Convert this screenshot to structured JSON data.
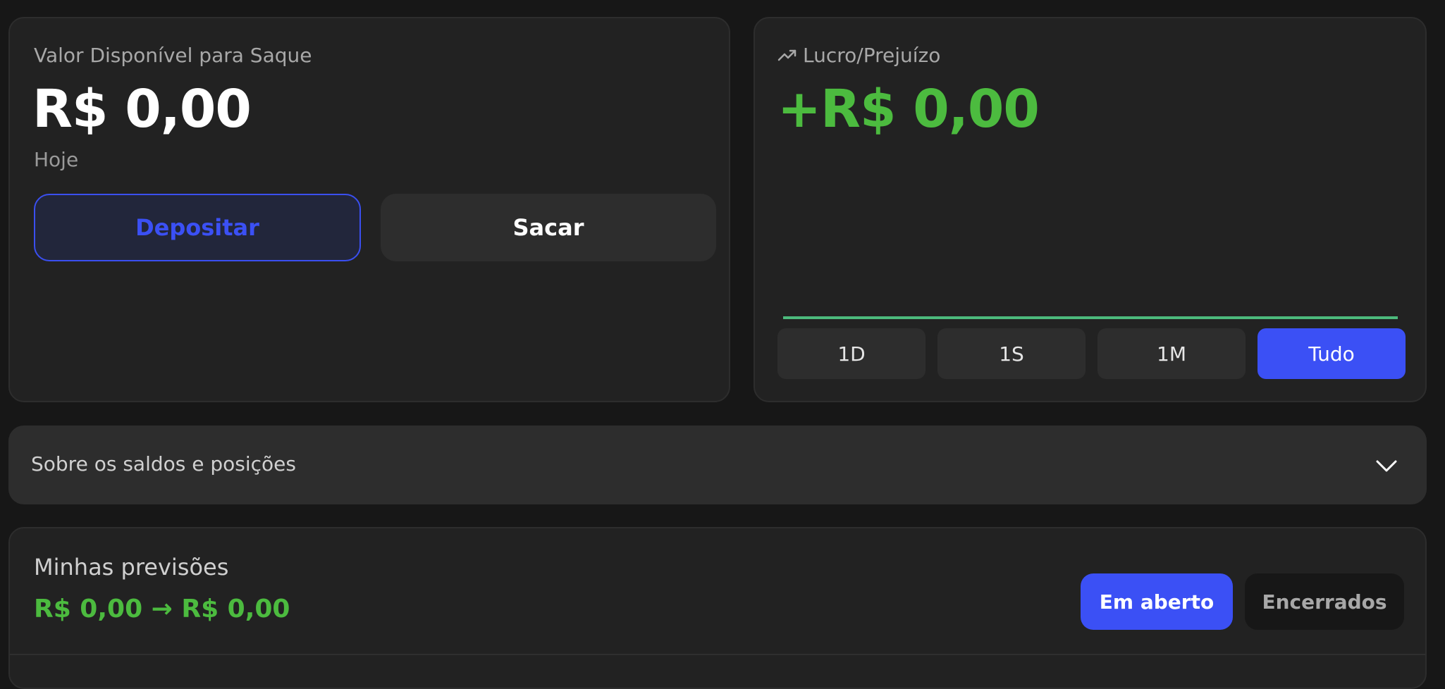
{
  "balance": {
    "label": "Valor Disponível para Saque",
    "amount": "R$ 0,00",
    "period": "Hoje",
    "deposit_label": "Depositar",
    "withdraw_label": "Sacar"
  },
  "profit": {
    "label": "Lucro/Prejuízo",
    "amount": "+R$ 0,00",
    "ranges": [
      {
        "label": "1D",
        "active": false
      },
      {
        "label": "1S",
        "active": false
      },
      {
        "label": "1M",
        "active": false
      },
      {
        "label": "Tudo",
        "active": true
      }
    ],
    "line_color": "#4cba7c"
  },
  "info": {
    "label": "Sobre os saldos e posições"
  },
  "predictions": {
    "title": "Minhas previsões",
    "flow": "R$ 0,00 → R$ 0,00",
    "open_label": "Em aberto",
    "closed_label": "Encerrados"
  },
  "colors": {
    "accent": "#3b50f5",
    "positive": "#4cbb3f",
    "background": "#171717",
    "card": "#222222"
  },
  "icons": {
    "trend": "trending-up-icon",
    "chevron": "chevron-down-icon"
  }
}
